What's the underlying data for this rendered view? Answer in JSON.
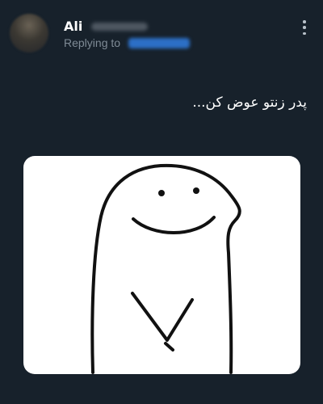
{
  "author": {
    "name": "Ali"
  },
  "reply": {
    "label": "Replying to"
  },
  "tweet": {
    "text": "پدر زنتو عوض کن..."
  },
  "icons": {
    "more": "more-vertical-icon"
  },
  "colors": {
    "background": "#17212b",
    "text": "#ffffff",
    "muted": "#7f8b96",
    "link": "#2c6fc6"
  }
}
